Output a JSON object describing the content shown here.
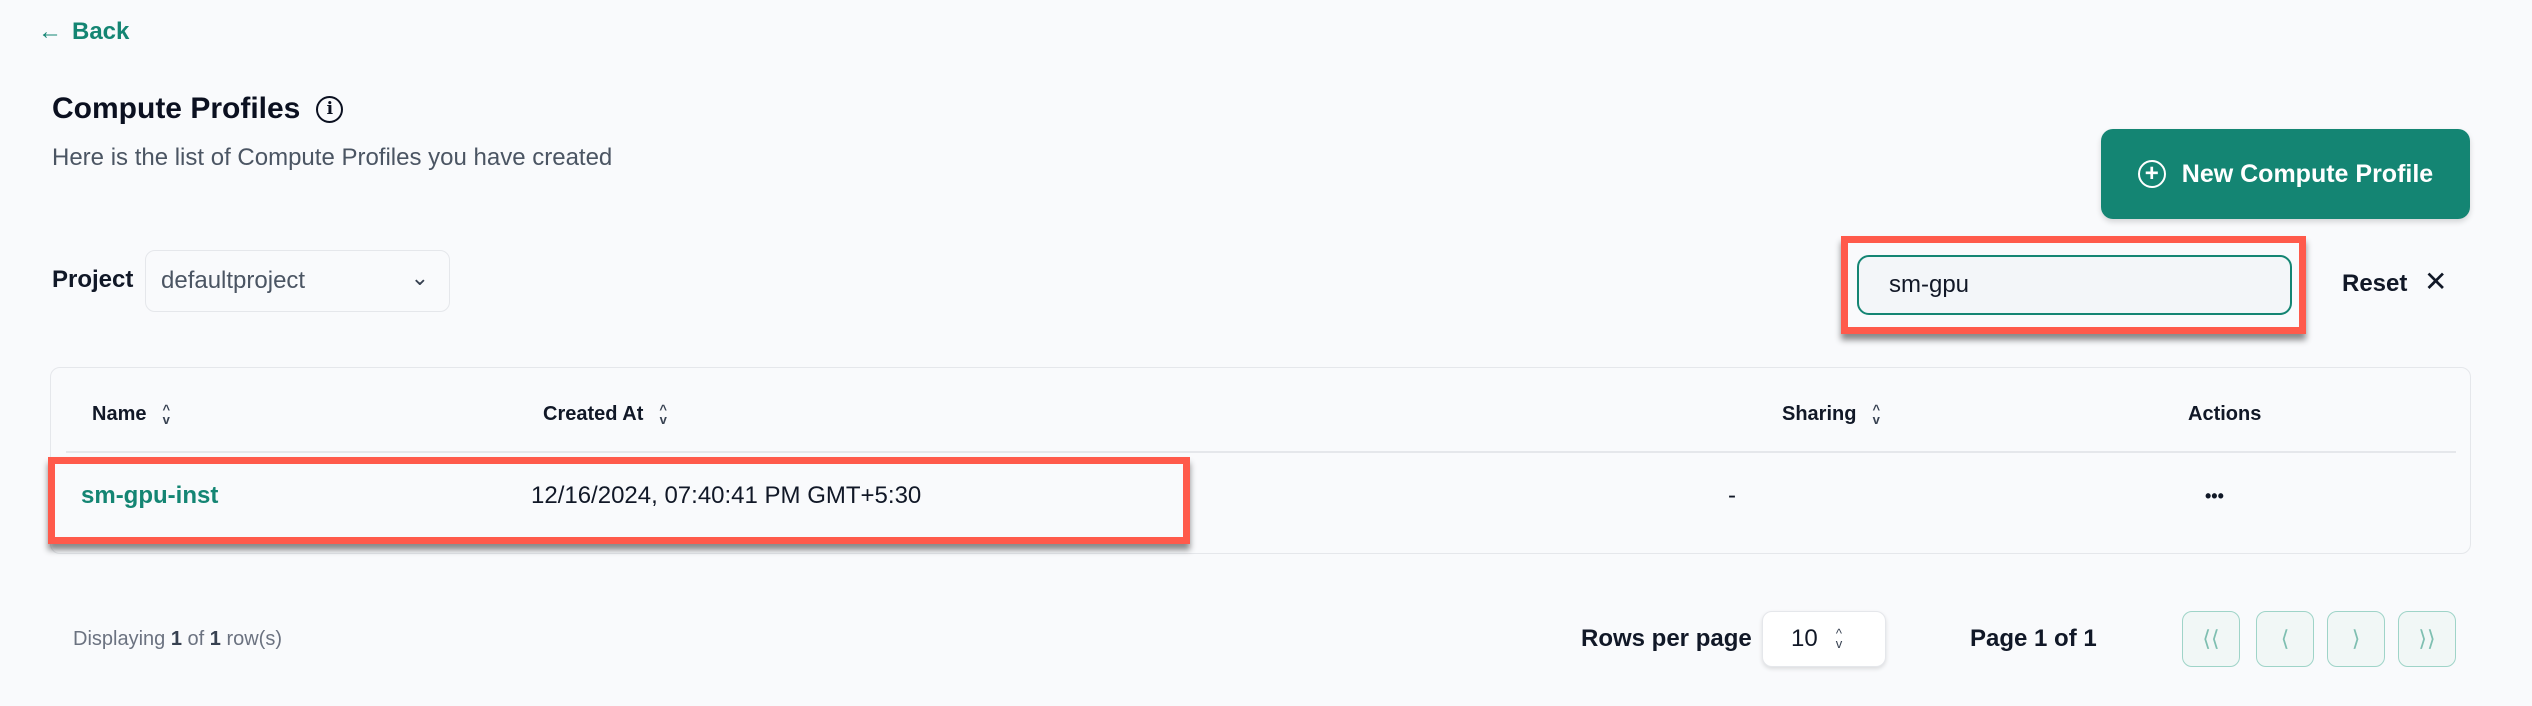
{
  "nav": {
    "back_label": "Back",
    "back_icon": "arrow-left-icon"
  },
  "header": {
    "title": "Compute Profiles",
    "subtitle": "Here is the list of Compute Profiles you have created",
    "new_button_label": "New Compute Profile"
  },
  "filters": {
    "project_label": "Project",
    "project_value": "defaultproject",
    "search_value": "sm-gpu",
    "reset_label": "Reset"
  },
  "table": {
    "columns": [
      {
        "label": "Name",
        "sortable": true
      },
      {
        "label": "Created At",
        "sortable": true
      },
      {
        "label": "Sharing",
        "sortable": true
      },
      {
        "label": "Actions",
        "sortable": false
      }
    ],
    "rows": [
      {
        "name": "sm-gpu-inst",
        "created_at": "12/16/2024, 07:40:41 PM GMT+5:30",
        "sharing": "-",
        "actions": "•••"
      }
    ]
  },
  "footer": {
    "displaying_prefix": "Displaying",
    "shown": "1",
    "of": "of",
    "total": "1",
    "suffix": "row(s)",
    "rows_per_page_label": "Rows per page",
    "rows_per_page_value": "10",
    "page_label": "Page 1 of 1"
  },
  "colors": {
    "accent": "#148573",
    "highlight": "#ff5a4b"
  }
}
